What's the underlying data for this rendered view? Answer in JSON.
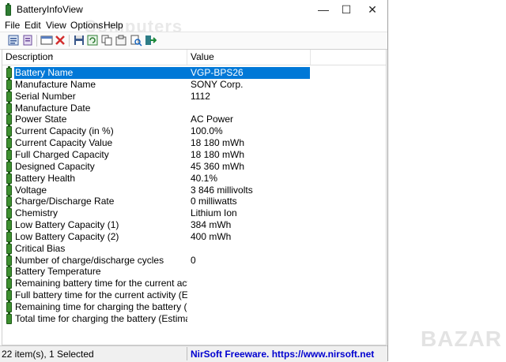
{
  "window": {
    "title": "BatteryInfoView"
  },
  "window_controls": {
    "minimize": "—",
    "maximize": "☐",
    "close": "✕"
  },
  "menu": [
    "File",
    "Edit",
    "View",
    "Options",
    "Help"
  ],
  "toolbar": {
    "icons": [
      "properties-icon",
      "battery-log-icon",
      "html-report-icon",
      "delete-icon",
      "save-icon",
      "refresh-icon",
      "copy-icon",
      "copy-selected-icon",
      "find-icon",
      "exit-icon"
    ]
  },
  "columns": {
    "description": "Description",
    "value": "Value"
  },
  "rows": [
    {
      "name": "Battery Name",
      "value": "VGP-BPS26"
    },
    {
      "name": "Manufacture Name",
      "value": "SONY Corp."
    },
    {
      "name": "Serial Number",
      "value": "1112"
    },
    {
      "name": "Manufacture Date",
      "value": ""
    },
    {
      "name": "Power State",
      "value": "AC Power"
    },
    {
      "name": "Current Capacity (in %)",
      "value": "100.0%"
    },
    {
      "name": "Current Capacity Value",
      "value": "18 180 mWh"
    },
    {
      "name": "Full Charged Capacity",
      "value": "18 180 mWh"
    },
    {
      "name": "Designed Capacity",
      "value": "45 360 mWh"
    },
    {
      "name": "Battery Health",
      "value": "40.1%"
    },
    {
      "name": "Voltage",
      "value": "3 846 millivolts"
    },
    {
      "name": "Charge/Discharge Rate",
      "value": "0 milliwatts"
    },
    {
      "name": "Chemistry",
      "value": "Lithium Ion"
    },
    {
      "name": "Low Battery Capacity (1)",
      "value": "384 mWh"
    },
    {
      "name": "Low Battery Capacity (2)",
      "value": "400 mWh"
    },
    {
      "name": "Critical Bias",
      "value": ""
    },
    {
      "name": "Number of charge/discharge cycles",
      "value": "0"
    },
    {
      "name": "Battery Temperature",
      "value": ""
    },
    {
      "name": "Remaining battery time for the current activity (Est...",
      "value": ""
    },
    {
      "name": "Full battery time for the current activity (Estimated)",
      "value": ""
    },
    {
      "name": "Remaining time for charging the battery (Estimated)",
      "value": ""
    },
    {
      "name": "Total  time for charging the battery (Estimated)",
      "value": ""
    }
  ],
  "selected_index": 0,
  "status": {
    "items": "22 item(s), 1 Selected",
    "credit": "NirSoft Freeware. https://www.nirsoft.net"
  },
  "watermark": "Computers",
  "brand_logo": "BAZAR",
  "colors": {
    "selection": "#0078d7",
    "battery_icon": "#3d8f2f",
    "credit_link": "#0000d0"
  }
}
